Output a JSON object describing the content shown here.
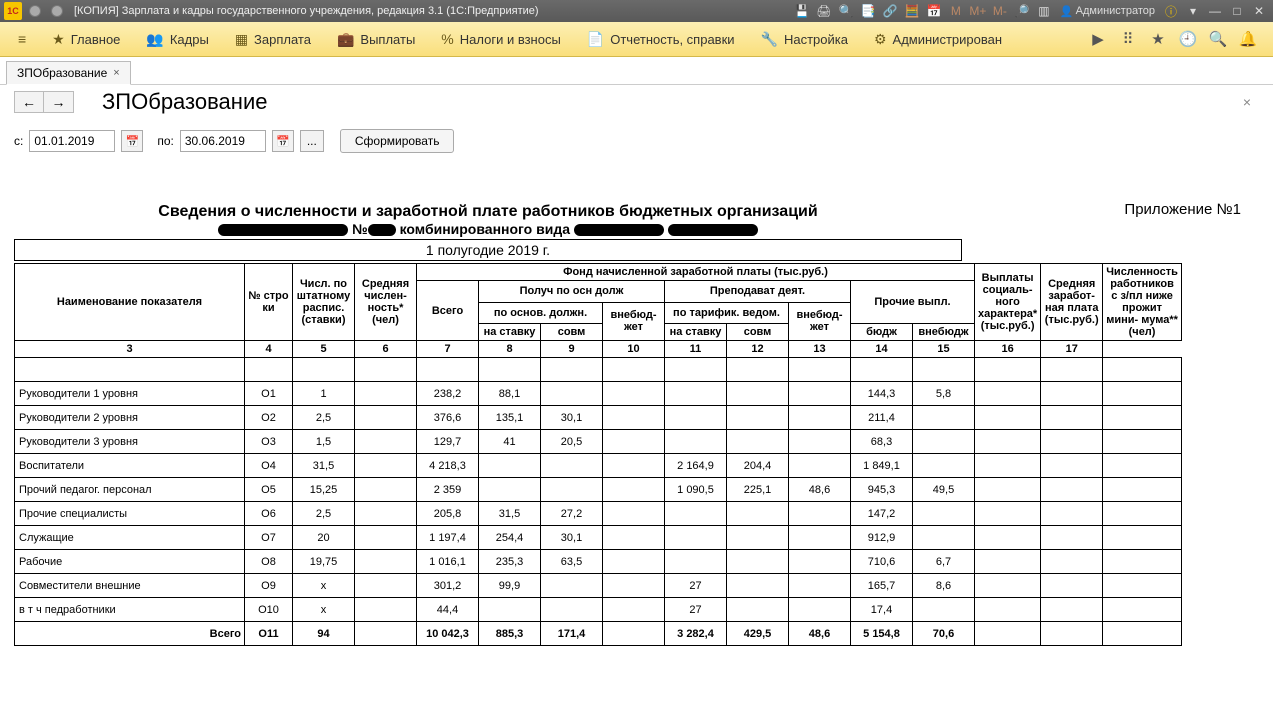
{
  "titlebar": {
    "logo": "1C",
    "title": "[КОПИЯ] Зарплата и кадры государственного учреждения, редакция 3.1  (1С:Предприятие)",
    "user": "Администратор",
    "m": "M",
    "mplus": "M+",
    "mminus": "M-"
  },
  "menu": {
    "items": [
      "Главное",
      "Кадры",
      "Зарплата",
      "Выплаты",
      "Налоги и взносы",
      "Отчетность, справки",
      "Настройка",
      "Администрирован"
    ]
  },
  "tab": {
    "label": "ЗПОбразование"
  },
  "page": {
    "title": "ЗПОбразование"
  },
  "filter": {
    "from_lbl": "с:",
    "from": "01.01.2019",
    "to_lbl": "по:",
    "to": "30.06.2019",
    "dots": "...",
    "form_btn": "Сформировать"
  },
  "report": {
    "title": "Сведения о численности и заработной плате работников бюджетных организаций",
    "sub_mid": "комбинированного вида",
    "sub_no": "№",
    "appendix": "Приложение №1",
    "period": "1 полугодие 2019 г.",
    "hdr": {
      "name": "Наименование показателя",
      "row": "№ стро ки",
      "staff": "Числ. по штатному распис. (ставки)",
      "avg": "Средняя числен- ность* (чел)",
      "fund": "Фонд начисленной заработной платы (тыс.руб.)",
      "total": "Всего",
      "main": "Получ по осн долж",
      "main_base": "по основ. должн.",
      "rate": "на ставку",
      "combo": "совм",
      "offb": "внебюд- жет",
      "teach": "Преподават деят.",
      "teach_base": "по тарифик. ведом.",
      "other": "Прочие выпл.",
      "budg": "бюдж",
      "offb2": "внебюдж",
      "soc": "Выплаты социаль- ного характера* (тыс.руб.)",
      "avg_pay": "Средняя заработ- ная плата (тыс.руб.)",
      "cnt_low": "Численность работников с з/пл ниже прожит мини- мума**(чел)"
    },
    "colnums": [
      "3",
      "4",
      "5",
      "6",
      "7",
      "8",
      "9",
      "10",
      "11",
      "12",
      "13",
      "14",
      "15",
      "16",
      "17"
    ],
    "rows": [
      {
        "lbl": "Руководители 1 уровня",
        "n": "О1",
        "c": [
          "1",
          "",
          "238,2",
          "88,1",
          "",
          "",
          "",
          "",
          "",
          "144,3",
          "5,8",
          "",
          "",
          ""
        ]
      },
      {
        "lbl": "Руководители 2 уровня",
        "n": "О2",
        "c": [
          "2,5",
          "",
          "376,6",
          "135,1",
          "30,1",
          "",
          "",
          "",
          "",
          "211,4",
          "",
          "",
          "",
          ""
        ]
      },
      {
        "lbl": "Руководители 3 уровня",
        "n": "О3",
        "c": [
          "1,5",
          "",
          "129,7",
          "41",
          "20,5",
          "",
          "",
          "",
          "",
          "68,3",
          "",
          "",
          "",
          ""
        ]
      },
      {
        "lbl": "Воспитатели",
        "n": "О4",
        "c": [
          "31,5",
          "",
          "4 218,3",
          "",
          "",
          "",
          "2 164,9",
          "204,4",
          "",
          "1 849,1",
          "",
          "",
          "",
          ""
        ]
      },
      {
        "lbl": "Прочий педагог. персонал",
        "n": "О5",
        "c": [
          "15,25",
          "",
          "2 359",
          "",
          "",
          "",
          "1 090,5",
          "225,1",
          "48,6",
          "945,3",
          "49,5",
          "",
          "",
          ""
        ]
      },
      {
        "lbl": "Прочие специалисты",
        "n": "О6",
        "c": [
          "2,5",
          "",
          "205,8",
          "31,5",
          "27,2",
          "",
          "",
          "",
          "",
          "147,2",
          "",
          "",
          "",
          ""
        ]
      },
      {
        "lbl": "Служащие",
        "n": "О7",
        "c": [
          "20",
          "",
          "1 197,4",
          "254,4",
          "30,1",
          "",
          "",
          "",
          "",
          "912,9",
          "",
          "",
          "",
          ""
        ]
      },
      {
        "lbl": "Рабочие",
        "n": "О8",
        "c": [
          "19,75",
          "",
          "1 016,1",
          "235,3",
          "63,5",
          "",
          "",
          "",
          "",
          "710,6",
          "6,7",
          "",
          "",
          ""
        ]
      },
      {
        "lbl": "Совместители внешние",
        "n": "О9",
        "c": [
          "х",
          "",
          "301,2",
          "99,9",
          "",
          "",
          "27",
          "",
          "",
          "165,7",
          "8,6",
          "",
          "",
          ""
        ]
      },
      {
        "lbl": "в т ч педработники",
        "n": "О10",
        "c": [
          "х",
          "",
          "44,4",
          "",
          "",
          "",
          "27",
          "",
          "",
          "17,4",
          "",
          "",
          "",
          ""
        ]
      }
    ],
    "total": {
      "lbl": "Всего",
      "n": "О11",
      "c": [
        "94",
        "",
        "10 042,3",
        "885,3",
        "171,4",
        "",
        "3 282,4",
        "429,5",
        "48,6",
        "5 154,8",
        "70,6",
        "",
        "",
        ""
      ]
    }
  }
}
